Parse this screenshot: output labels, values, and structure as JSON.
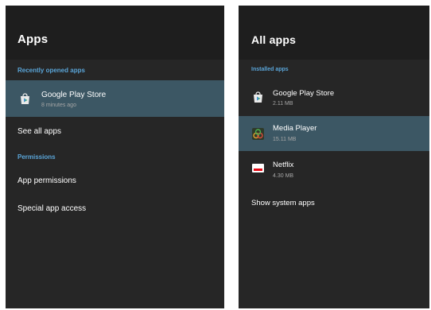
{
  "left": {
    "title": "Apps",
    "recent_header": "Recently opened apps",
    "recent_app": {
      "name": "Google Play Store",
      "time": "8 minutes ago",
      "icon": "play-store-icon"
    },
    "see_all": "See all apps",
    "permissions_header": "Permissions",
    "app_permissions": "App permissions",
    "special_access": "Special app access"
  },
  "right": {
    "title": "All apps",
    "installed_header": "Installed apps",
    "apps": [
      {
        "name": "Google Play Store",
        "size": "2.11 MB",
        "icon": "play-store-icon"
      },
      {
        "name": "Media Player",
        "size": "15.11 MB",
        "icon": "media-player-icon"
      },
      {
        "name": "Netflix",
        "size": "4.30 MB",
        "icon": "netflix-icon"
      }
    ],
    "show_system": "Show system apps"
  },
  "colors": {
    "background": "#262626",
    "header": "#1e1e1e",
    "accent": "#5aa5d8",
    "selected": "#3c5764",
    "netflix_red": "#e50914"
  }
}
